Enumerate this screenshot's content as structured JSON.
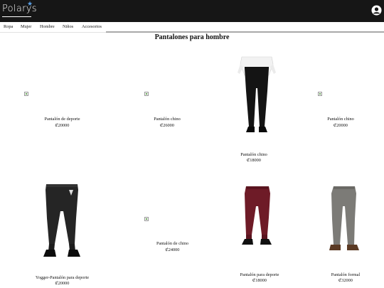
{
  "brand": {
    "logo_text": "Polarys",
    "star": "★"
  },
  "header": {
    "user_icon": "user-circle-icon"
  },
  "nav": {
    "items": [
      "Ropa",
      "Mujer",
      "Hombre",
      "Niños",
      "Accesorios"
    ],
    "active": "Accesorios"
  },
  "page": {
    "title": "Pantalones para hombre"
  },
  "products": [
    {
      "name": "Pantalón de deporte",
      "price": "₡20000",
      "image": "broken-image-icon"
    },
    {
      "name": "Pantalón chino",
      "price": "₡26000",
      "image": "broken-image-icon"
    },
    {
      "name": "Pantalón chino",
      "price": "₡18000",
      "image": "black-trousers-white-shirt"
    },
    {
      "name": "Pantalón chino",
      "price": "₡20000",
      "image": "broken-image-icon"
    },
    {
      "name": "Yogger-Pantalón para deporte",
      "price": "₡20000",
      "image": "black-jogger-pants"
    },
    {
      "name": "Pantalón de chino",
      "price": "₡24000",
      "image": "broken-image-icon"
    },
    {
      "name": "Pantalón para deporte",
      "price": "₡18000",
      "image": "burgundy-jogger-pants"
    },
    {
      "name": "Pantalón formal",
      "price": "₡32000",
      "image": "grey-trousers"
    }
  ],
  "colors": {
    "header_bg": "#161616",
    "accent_star": "#5aa0e6",
    "burgundy": "#6e1b27",
    "grey_pants": "#7c7b77"
  }
}
